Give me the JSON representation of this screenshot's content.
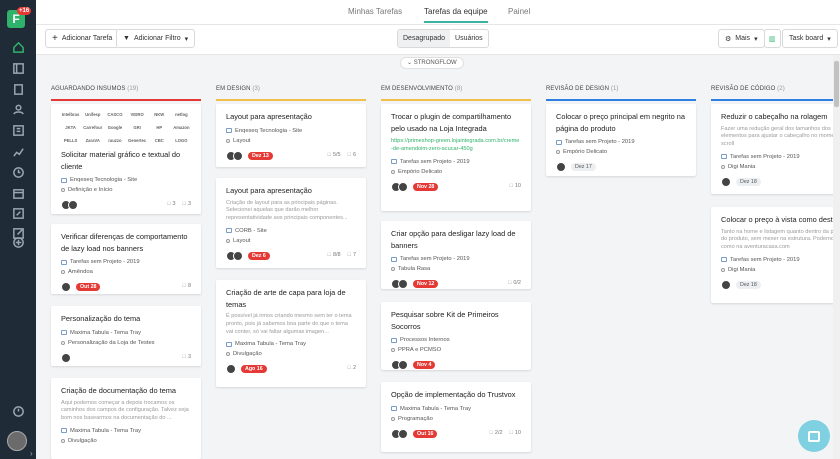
{
  "app": {
    "badge": "+16"
  },
  "tabs": [
    {
      "label": "Minhas Tarefas"
    },
    {
      "label": "Tarefas da equipe"
    },
    {
      "label": "Painel"
    }
  ],
  "toolbar": {
    "add_task": "Adicionar Tarefa",
    "add_filter": "Adicionar Filtro",
    "ungrouped": "Desagrupado",
    "users": "Usuários",
    "more": "Mais",
    "view": "Task board"
  },
  "group_label": "STRONGFLOW",
  "accent_colors": {
    "col1": "#e53935",
    "col2": "#f2c04a",
    "col3": "#f2c04a",
    "col4": "#2e7fe0",
    "col5": "#2e7fe0",
    "active_tab": "#3bb3a0",
    "brand": "#2fb36b"
  },
  "columns": [
    {
      "title": "AGUARDANDO INSUMOS",
      "count": "(19)"
    },
    {
      "title": "EM DESIGN",
      "count": "(3)"
    },
    {
      "title": "EM DESENVOLVIMENTO",
      "count": "(8)"
    },
    {
      "title": "REVISÃO DE DESIGN",
      "count": "(1)"
    },
    {
      "title": "REVISÃO DE CÓDIGO",
      "count": "(2)"
    }
  ],
  "logo_grid": [
    "Intelbras",
    "Unifesp",
    "CASCO",
    "VIDRO",
    "NKW",
    "netlog",
    "JKTA",
    "Carrefour",
    "Google",
    "GRI",
    "HP",
    "Amazon",
    "PELLS",
    "ZaraVA",
    "rauzzo",
    "Genertec",
    "CBC",
    "LOGO"
  ],
  "cards": {
    "c1": {
      "title": "Solicitar material gráfico e textual do cliente",
      "project": "Enqeseq Tecnologia - Site",
      "status": "Definição e Início",
      "comments": "3",
      "subtasks": "3"
    },
    "c2": {
      "title": "Verificar diferenças de comportamento de lazy load nos banners",
      "project": "Tarefas sem Projeto - 2019",
      "status": "Amêndoa",
      "due": "Out 28",
      "comments": "8"
    },
    "c3": {
      "title": "Personalização do tema",
      "project": "Maxima Tabula - Tema Tray",
      "status": "Personalização da Loja de Testes",
      "comments": "3"
    },
    "c4": {
      "title": "Criação de documentação do tema",
      "desc": "Aqui podemos começar a depois trocamos os caminhos dos campos de configuração. Talvez seja bom nos basearmos na documentação do ...",
      "project": "Maxima Tabula - Tema Tray",
      "status": "Divulgação"
    },
    "d1": {
      "title": "Layout para apresentação",
      "project": "Enqeseq Tecnologia - Site",
      "status": "Layout",
      "due": "Dez 13",
      "checklist": "5/5",
      "comments": "6"
    },
    "d2": {
      "title": "Layout para apresentação",
      "desc": "Criação de layout para as principais páginas. Selecionei aquelas que darão melhor representatividade aos principais componentes...",
      "project": "CORB - Site",
      "status": "Layout",
      "due": "Dez 6",
      "checklist": "8/8",
      "comments": "7"
    },
    "d3": {
      "title": "Criação de arte de capa para loja de temas",
      "desc": "É possível já irmos criando mesmo sem ter o tema pronto, pois já sabemos boa parte do que o tema vai conter, só vai faltar algumas imagen...",
      "project": "Maxima Tabula - Tema Tray",
      "status": "Divulgação",
      "due": "Ago 16",
      "comments": "2"
    },
    "e1": {
      "title": "Trocar o plugin de compartilhamento pelo usado na Loja Integrada",
      "link": "https://primeshop-green.lojaintegrada.com.br/creme-de-amendoim-zero-acucar-450g",
      "project": "Tarefas sem Projeto - 2019",
      "status": "Empório Delicato",
      "due": "Nov 28",
      "comments": "10"
    },
    "e2": {
      "title": "Criar opção para desligar lazy load de banners",
      "project": "Tarefas sem Projeto - 2019",
      "status": "Tabula Rasa",
      "due": "Nov 12",
      "checklist": "0/2"
    },
    "e3": {
      "title": "Pesquisar sobre Kit de Primeiros Socorros",
      "project": "Processos Internos",
      "status": "PPRA e PCMSO",
      "due": "Nov 4"
    },
    "e4": {
      "title": "Opção de implementação do Trustvox",
      "project": "Maxima Tabula - Tema Tray",
      "status": "Programação",
      "due": "Out 16",
      "checklist": "2/2",
      "comments": "10"
    },
    "f1": {
      "title": "Colocar o preço principal em negrito na página do produto",
      "project": "Tarefas sem Projeto - 2019",
      "status": "Empório Delicato",
      "due": "Dez 17"
    },
    "g1": {
      "title": "Reduzir o cabeçalho na rolagem",
      "desc": "Fazer uma redução geral dos tamanhos dos elementos para ajustar o cabeçalho no momento do scroll",
      "project": "Tarefas sem Projeto - 2019",
      "status": "Digi Mania",
      "due": "Dez 18"
    },
    "g2": {
      "title": "Colocar o preço à vista como destaque",
      "desc": "Tanto na home e listagem quanto dentro da página do produto, sem mexer na estrutura. Podemos fazer como na aventuracasa.com",
      "project": "Tarefas sem Projeto - 2019",
      "status": "Digi Mania",
      "due": "Dez 18"
    }
  }
}
